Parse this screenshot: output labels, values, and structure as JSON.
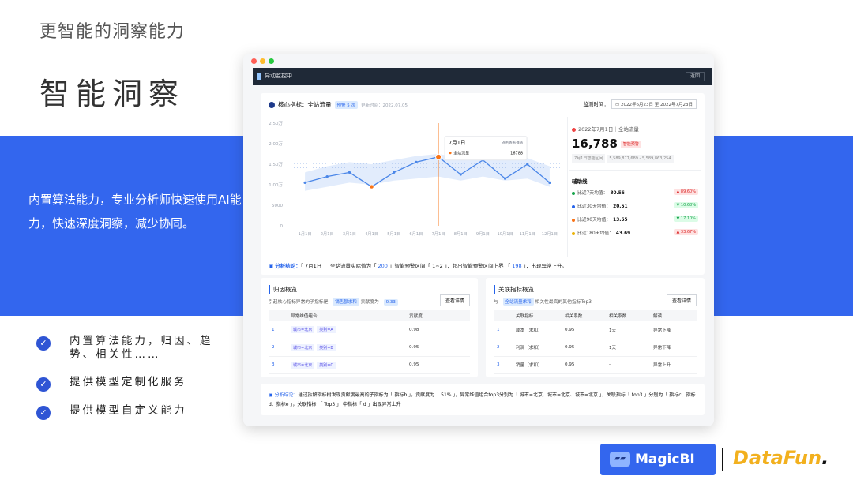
{
  "slide": {
    "top_title": "更智能的洞察能力",
    "main_title": "智能洞察",
    "band_text": "内置算法能力，专业分析师快速使用AI能力，快速深度洞察，减少协同。",
    "features": [
      {
        "icon": "check-circle-icon",
        "text": "内置算法能力，归因、趋势、相关性……"
      },
      {
        "icon": "check-circle-icon",
        "text": "提供模型定制化服务"
      },
      {
        "icon": "check-circle-icon",
        "text": "提供模型自定义能力"
      }
    ],
    "band_color": "#3366ee"
  },
  "app": {
    "title": "异动监控中",
    "back": "返回"
  },
  "core": {
    "title": "核心指标：全站流量",
    "tag": "预警 5 次",
    "updated": "更新时间：2022.07.05",
    "monitor_label": "监测时间：",
    "monitor_range": "2022年6月23日 至 2022年7月23日"
  },
  "chart_data": {
    "type": "line",
    "categories": [
      "1月1日",
      "2月1日",
      "3月1日",
      "4月1日",
      "5月1日",
      "6月1日",
      "7月1日",
      "8月1日",
      "9月1日",
      "10月1日",
      "11月1日",
      "12月1日"
    ],
    "y_ticks": [
      "0",
      "5000",
      "1.00万",
      "1.50万",
      "2.00万",
      "2.50万"
    ],
    "ylim": [
      0,
      25000
    ],
    "series": [
      {
        "values": [
          10500,
          12000,
          13000,
          9500,
          13000,
          15500,
          16788,
          12500,
          16000,
          11500,
          15000,
          10500
        ]
      }
    ],
    "band_upper": [
      13000,
      14500,
      15500,
      15000,
      16000,
      17000,
      17500,
      16500,
      17000,
      16000,
      16500,
      14500
    ],
    "band_lower": [
      8500,
      9500,
      10500,
      10000,
      11000,
      11500,
      12000,
      11000,
      12000,
      11000,
      11500,
      9500
    ],
    "anomalies": [
      3
    ],
    "highlight_index": 6,
    "tooltip": {
      "date": "7月1日",
      "link": "点击查看详情",
      "series": "全站流量",
      "value": "16788"
    },
    "line_color": "#4a86e8",
    "band_color": "#dbe7fb",
    "anomaly_color": "#f97316",
    "grid": false
  },
  "side": {
    "date": "2022年7月1日｜全站流量",
    "value": "16,788",
    "warn": "智能预警",
    "pred_label": "7月1日智能区间",
    "pred_range": "5,589,877,689 - 5,589,863,254",
    "aux_title": "辅助线",
    "aux": [
      {
        "label": "比近7天均值：",
        "value": "80.56",
        "pct": "89.60%",
        "color": "#16a34a",
        "tone": "red"
      },
      {
        "label": "比近30天均值：",
        "value": "20.51",
        "pct": "10.68%",
        "color": "#2563eb",
        "tone": "green"
      },
      {
        "label": "比近90天均值：",
        "value": "13.55",
        "pct": "17.10%",
        "color": "#f97316",
        "tone": "green"
      },
      {
        "label": "比近180天均值：",
        "value": "43.69",
        "pct": "33.67%",
        "color": "#eab308",
        "tone": "red"
      }
    ]
  },
  "conclusion1": {
    "label": "分析结论：",
    "p1": "「 7月1日 」 全站流量实际值为「 ",
    "v1": "200",
    "p2": " 」智能预警区间「 1~2 」，超出智能预警区间上界 「 ",
    "v2": "198",
    "p3": " 」，出现异常上升。"
  },
  "attribution": {
    "title": "归因概览",
    "sub1": "引起核心指标异常的子指标是",
    "tag": "销售额求和",
    "sub2": "贡献度为",
    "contrib": "0.33",
    "view": "查看详情",
    "headers": [
      "",
      "异常维值组合",
      "贡献度"
    ],
    "rows": [
      {
        "n": "1",
        "c1": "城市=北京",
        "c2": "类别=A",
        "v": "0.98"
      },
      {
        "n": "2",
        "c1": "城市=北京",
        "c2": "类别=B",
        "v": "0.95"
      },
      {
        "n": "3",
        "c1": "城市=北京",
        "c2": "类别=C",
        "v": "0.95"
      }
    ]
  },
  "relation": {
    "title": "关联指标概览",
    "sub1": "与",
    "tag": "全站流量求和",
    "sub2": "相关性最高的其他指标Top3",
    "view": "查看详情",
    "headers": [
      "",
      "关联指标",
      "相关系数",
      "相关系数",
      "解读"
    ],
    "rows": [
      {
        "n": "1",
        "name": "成本（求和）",
        "a": "0.95",
        "b": "1天",
        "r": "异常下降"
      },
      {
        "n": "2",
        "name": "利润（求和）",
        "a": "0.95",
        "b": "1天",
        "r": "异常下降"
      },
      {
        "n": "3",
        "name": "销量（求和）",
        "a": "0.95",
        "b": "-",
        "r": "异常上升"
      }
    ]
  },
  "conclusion2": {
    "label": "分析结论：",
    "text": "通过拆解指标树发现贡献度最高的子指标为「 指标b 」，贡献度为「 51% 」，异常维值组合top3分别为「 城市=北京、城市=北京、城市=北京 」，关联指标「 top3 」分别为「 指标c、指标d、指标e 」，关联指标 「 Top3 」 中指标「 d 」出现异常上升"
  },
  "logos": {
    "magicbi": "MagicBI",
    "datafun_a": "DataFun",
    "datafun_b": "."
  }
}
